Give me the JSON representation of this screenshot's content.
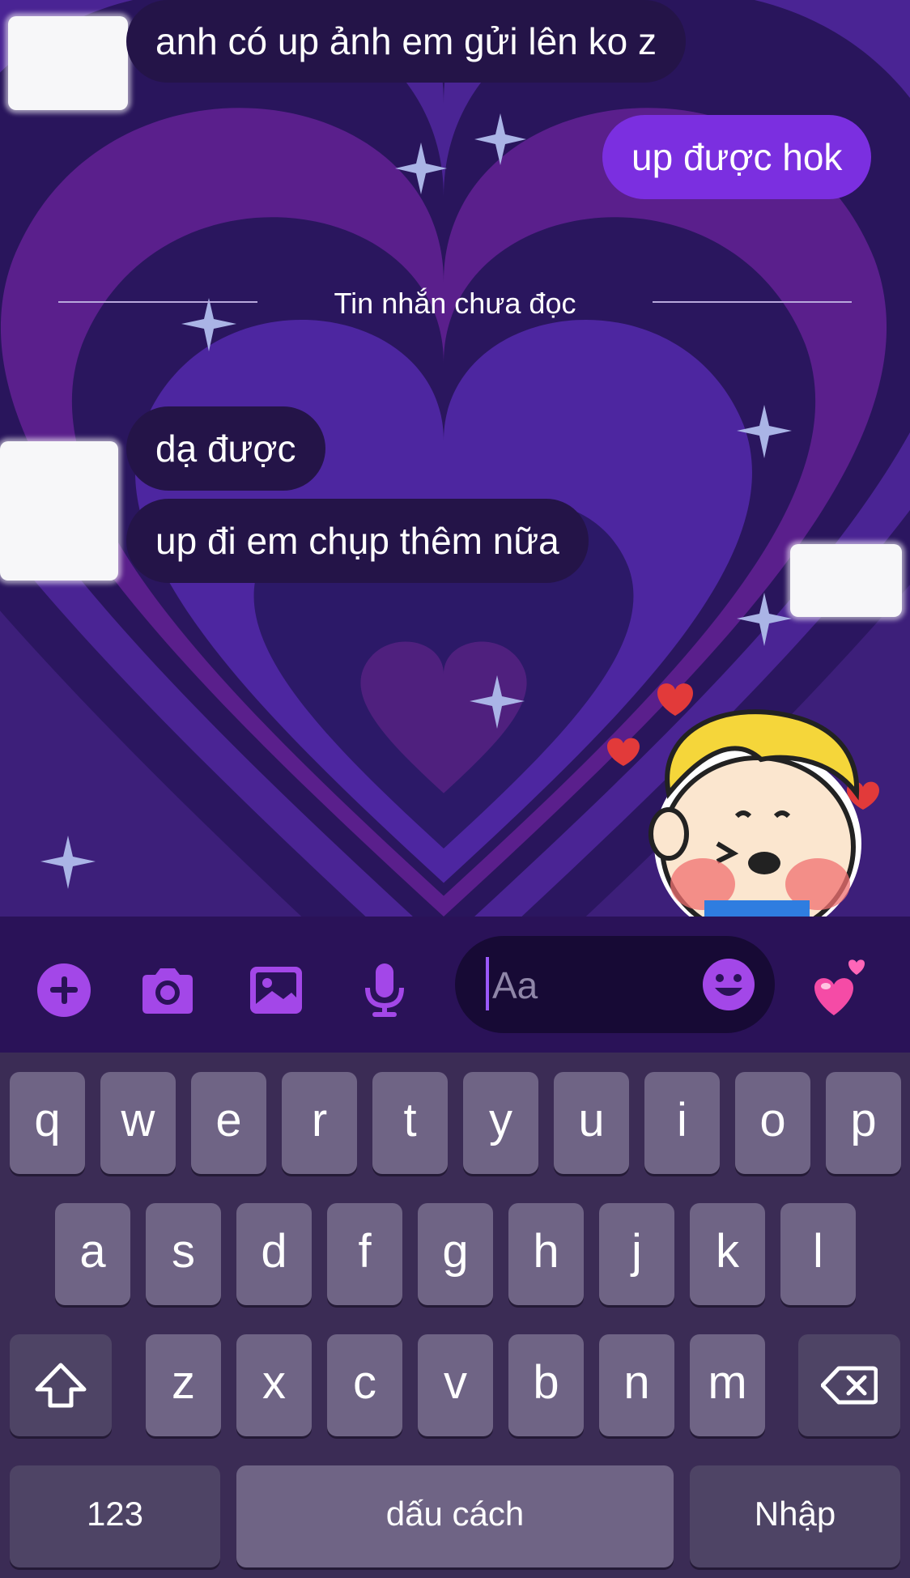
{
  "messages": {
    "incoming_1": "anh có up ảnh em gửi lên ko z",
    "outgoing_1": "up được hok",
    "unread_divider": "Tin nhắn chưa đọc",
    "incoming_2": "dạ được",
    "incoming_3": "up đi em chụp thêm nữa"
  },
  "composer": {
    "placeholder": "Aa",
    "icons": [
      "plus-icon",
      "camera-icon",
      "gallery-icon",
      "microphone-icon",
      "emoji-icon",
      "hearts-icon"
    ]
  },
  "keyboard": {
    "row1": [
      "q",
      "w",
      "e",
      "r",
      "t",
      "y",
      "u",
      "i",
      "o",
      "p"
    ],
    "row2": [
      "a",
      "s",
      "d",
      "f",
      "g",
      "h",
      "j",
      "k",
      "l"
    ],
    "row3": [
      "z",
      "x",
      "c",
      "v",
      "b",
      "n",
      "m"
    ],
    "numbers_label": "123",
    "space_label": "dấu cách",
    "return_label": "Nhập"
  },
  "theme": {
    "accent": "#7b2fe0",
    "chat_bg": "#3d1f7a",
    "incoming_bubble": "#241448"
  }
}
